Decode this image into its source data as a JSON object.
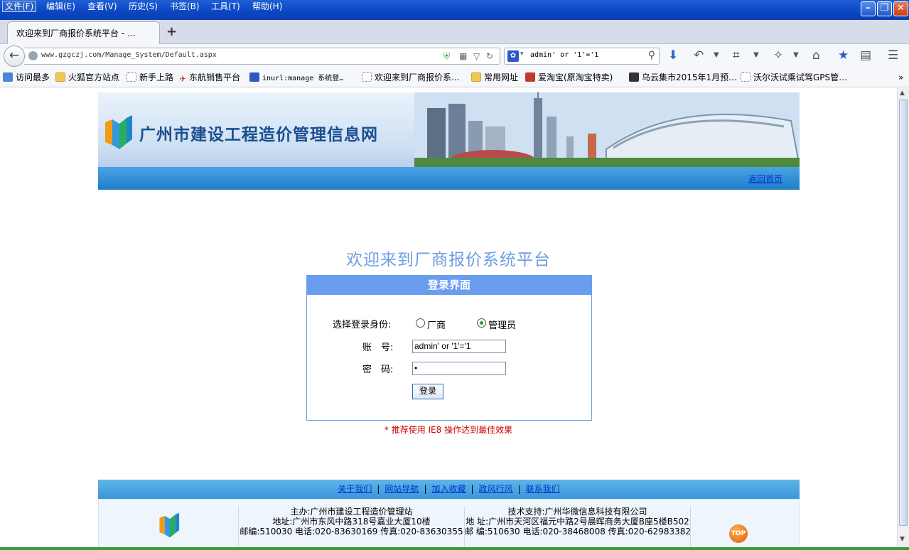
{
  "browser": {
    "menu": [
      "文件(F)",
      "编辑(E)",
      "查看(V)",
      "历史(S)",
      "书签(B)",
      "工具(T)",
      "帮助(H)"
    ],
    "tab_title": "欢迎来到厂商报价系统平台 - …",
    "url": "www.gzgczj.com/Manage_System/Default.aspx",
    "search_query": "admin' or '1'='1",
    "bookmarks": [
      "访问最多",
      "火狐官方站点",
      "新手上路",
      "东航销售平台",
      "inurl:manage 系统登…",
      "欢迎来到厂商报价系…",
      "常用网址",
      "爱淘宝(原淘宝特卖)",
      "乌云集市2015年1月预…",
      "沃尔沃试乘试驾GPS管…"
    ]
  },
  "header": {
    "site_title": "广州市建设工程造价管理信息网",
    "home_link": "返回首页"
  },
  "login": {
    "welcome": "欢迎来到厂商报价系统平台",
    "panel_title": "登录界面",
    "identity_label": "选择登录身份:",
    "role_vendor": "厂商",
    "role_admin": "管理员",
    "selected_role": "管理员",
    "account_label": "账　号:",
    "account_value": "admin' or '1'='1",
    "password_label": "密　码:",
    "password_value": "•",
    "submit_label": "登录",
    "tip": "* 推荐使用 IE8 操作达到最佳效果"
  },
  "footer": {
    "links": [
      "关于我们",
      "网站导航",
      "加入收藏",
      "政风行风",
      "联系我们"
    ],
    "host_lines": [
      "主办:广州市建设工程造价管理站",
      "地址:广州市东风中路318号嘉业大厦10楼",
      "邮编:510030  电话:020-83630169  传真:020-83630355"
    ],
    "support_lines": [
      "技术支持:广州华微信息科技有限公司",
      "地 址:广州市天河区福元中路2号晨晖商务大厦B座5楼B502",
      "邮 编:510630  电话:020-38468008  传真:020-62983382"
    ],
    "top_label": "TOP"
  },
  "colors": {
    "accent_blue": "#6a9cf0",
    "tip_red": "#cc0000",
    "link_blue": "#0033cc"
  }
}
